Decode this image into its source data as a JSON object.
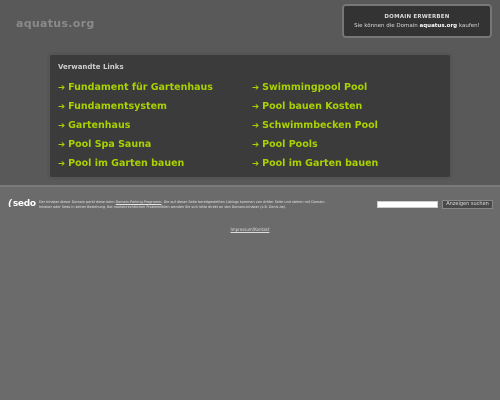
{
  "header": {
    "domain": "aquatus.org"
  },
  "buy_box": {
    "title": "DOMAIN ERWERBEN",
    "text_before": "Sie können die Domain",
    "domain": "aquatus.org",
    "text_after": "kaufen!"
  },
  "links_panel": {
    "title": "Verwandte Links",
    "arrow": "➔",
    "left": [
      "Fundament für Gartenhaus",
      "Fundamentsystem",
      "Gartenhaus",
      "Pool Spa Sauna",
      "Pool im Garten bauen"
    ],
    "right": [
      "Swimmingpool Pool",
      "Pool bauen Kosten",
      "Schwimmbecken Pool",
      "Pool Pools",
      "Pool im Garten bauen"
    ]
  },
  "footer": {
    "logo": "sedo",
    "disclaimer_1": "Der Inhaber dieser Domain parkt diese beim",
    "disclaimer_link": "Domain-Parking-Programm",
    "disclaimer_2": ". Die auf dieser Seite bereitgestellten Listings kommen von dritter Seite und stehen mit Domain-Inhaber oder Sedo in keiner Beziehung. Bei markenrechtlichen Problemfällen wenden Sie sich bitte direkt an den Domain-Inhaber (z.B. Denic.de).",
    "search_button": "Anzeigen suchen",
    "search_value": "",
    "impressum": "Impressum/Kontakt"
  },
  "colors": {
    "background": "#6b6b6b",
    "header_background": "#595959",
    "panel_background": "#3b3b3b",
    "link_color": "#a9d200"
  }
}
